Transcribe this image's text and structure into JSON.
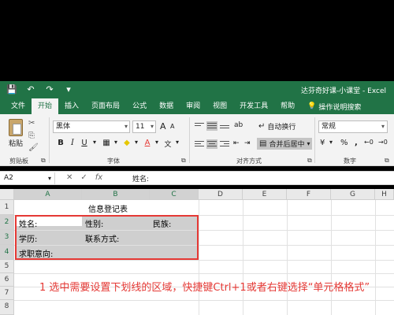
{
  "window": {
    "title": "达芬奇好课-小课堂  -  Excel"
  },
  "qat": {
    "save_glyph": "💾",
    "undo_glyph": "↶",
    "redo_glyph": "↷",
    "more_glyph": "▾"
  },
  "tabs": [
    "文件",
    "开始",
    "插入",
    "页面布局",
    "公式",
    "数据",
    "审阅",
    "视图",
    "开发工具",
    "帮助"
  ],
  "active_tab": "开始",
  "help_search": {
    "icon": "lightbulb-icon",
    "glyph": "💡",
    "label": "操作说明搜索"
  },
  "ribbon": {
    "clipboard": {
      "paste_label": "粘贴",
      "group_label": "剪贴板",
      "cut_glyph": "✂",
      "copy_glyph": "⎘",
      "format_painter_glyph": "🖌"
    },
    "font": {
      "font_name": "黑体",
      "font_size": "11",
      "grow_glyph": "A",
      "shrink_glyph": "A",
      "bold": "B",
      "italic": "I",
      "underline": "U",
      "border_glyph": "▦",
      "fill_glyph": "◆",
      "color_glyph": "A",
      "wen_glyph": "文",
      "dropdown_glyph": "▾",
      "group_label": "字体"
    },
    "alignment": {
      "wrap_label": "自动换行",
      "merge_label": "合并后居中",
      "group_label": "对齐方式",
      "orient_glyph": "ab",
      "indent_dec_glyph": "⇤",
      "indent_inc_glyph": "⇥"
    },
    "number": {
      "format": "常规",
      "currency_glyph": "¥",
      "percent_glyph": "%",
      "comma_glyph": ",",
      "inc_decimal_glyph": "←0",
      "dec_decimal_glyph": "→0",
      "group_label": "数字"
    },
    "launcher_glyph": "⧉"
  },
  "formula_bar": {
    "name_box": "A2",
    "cancel_glyph": "✕",
    "enter_glyph": "✓",
    "fx_glyph": "fx",
    "dropdown_glyph": "▾",
    "content": "姓名:"
  },
  "sheet": {
    "columns": [
      "A",
      "B",
      "C",
      "D",
      "E",
      "F",
      "G",
      "H"
    ],
    "rows": [
      "1",
      "2",
      "3",
      "4",
      "5",
      "6",
      "7",
      "8"
    ],
    "cells": {
      "b1": "信息登记表",
      "a2": "姓名:",
      "b2": "性别:",
      "c2": "民族:",
      "a3": "学历:",
      "b3": "联系方式:",
      "a4": "求职意向:"
    }
  },
  "annotation": "1 选中需要设置下划线的区域，快捷键Ctrl+1或者右键选择“单元格格式”",
  "colors": {
    "excel_green": "#217346",
    "highlight_red": "#e53935"
  }
}
